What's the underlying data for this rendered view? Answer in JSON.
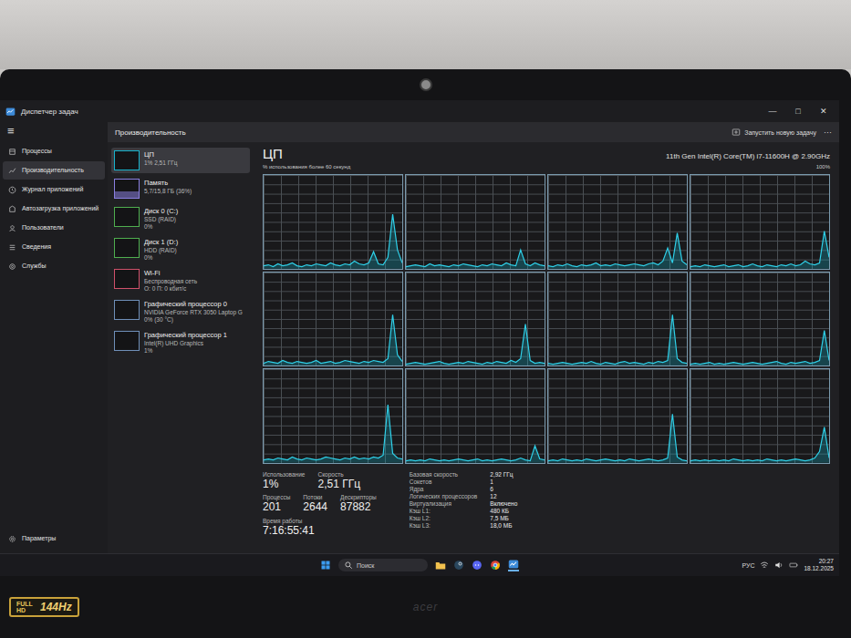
{
  "window": {
    "title": "Диспетчер задач",
    "controls": [
      "—",
      "□",
      "✕"
    ]
  },
  "nav": {
    "menu_glyph": "≡",
    "items": [
      {
        "label": "Процессы",
        "selected": false
      },
      {
        "label": "Производительность",
        "selected": true
      },
      {
        "label": "Журнал приложений",
        "selected": false
      },
      {
        "label": "Автозагрузка приложений",
        "selected": false
      },
      {
        "label": "Пользователи",
        "selected": false
      },
      {
        "label": "Сведения",
        "selected": false
      },
      {
        "label": "Службы",
        "selected": false
      }
    ],
    "footer": "Параметры"
  },
  "header": {
    "title": "Производительность",
    "action": "Запустить новую задачу",
    "more": "···"
  },
  "devices": [
    {
      "name": "ЦП",
      "lines": [
        "1% 2,51 ГГц"
      ],
      "selected": true,
      "color": "#17b3cc",
      "level": 0.01
    },
    {
      "name": "Память",
      "lines": [
        "5,7/15,8 ГБ (36%)"
      ],
      "selected": false,
      "color": "#8a7fe0",
      "level": 0.36
    },
    {
      "name": "Диск 0 (C:)",
      "lines": [
        "SSD (RAID)",
        "0%"
      ],
      "selected": false,
      "color": "#4fae4f",
      "level": 0
    },
    {
      "name": "Диск 1 (D:)",
      "lines": [
        "HDD (RAID)",
        "0%"
      ],
      "selected": false,
      "color": "#4fae4f",
      "level": 0
    },
    {
      "name": "Wi-Fi",
      "lines": [
        "Беспроводная сеть",
        "О: 0 П: 0 кбит/с"
      ],
      "selected": false,
      "color": "#d0506a",
      "level": 0
    },
    {
      "name": "Графический процессор 0",
      "lines": [
        "NVIDIA GeForce RTX 3050 Laptop G",
        "0% (30 °C)"
      ],
      "selected": false,
      "color": "#6f8fb8",
      "level": 0
    },
    {
      "name": "Графический процессор 1",
      "lines": [
        "Intel(R) UHD Graphics",
        "1%"
      ],
      "selected": false,
      "color": "#6f8fb8",
      "level": 0.01
    }
  ],
  "cpu": {
    "title": "ЦП",
    "model": "11th Gen Intel(R) Core(TM) i7-11600H @ 2.90GHz",
    "chart_caption": "% использования более 60 секунд",
    "chart_max": "100%",
    "series": [
      [
        3,
        4,
        2,
        5,
        3,
        4,
        6,
        3,
        2,
        4,
        3,
        5,
        4,
        3,
        6,
        4,
        3,
        5,
        4,
        8,
        5,
        4,
        6,
        18,
        5,
        4,
        12,
        58,
        20,
        6
      ],
      [
        2,
        3,
        4,
        3,
        2,
        5,
        3,
        4,
        3,
        2,
        4,
        3,
        5,
        4,
        3,
        2,
        4,
        3,
        5,
        4,
        3,
        6,
        4,
        3,
        20,
        5,
        3,
        6,
        4,
        3
      ],
      [
        3,
        2,
        4,
        3,
        5,
        3,
        2,
        4,
        3,
        4,
        6,
        3,
        4,
        3,
        5,
        4,
        3,
        4,
        5,
        4,
        3,
        5,
        6,
        4,
        8,
        22,
        6,
        38,
        8,
        4
      ],
      [
        2,
        3,
        2,
        4,
        3,
        2,
        3,
        4,
        2,
        3,
        4,
        2,
        3,
        5,
        3,
        2,
        4,
        3,
        2,
        4,
        3,
        5,
        3,
        4,
        8,
        5,
        4,
        6,
        40,
        12
      ],
      [
        3,
        5,
        4,
        3,
        6,
        4,
        3,
        5,
        4,
        3,
        4,
        6,
        3,
        4,
        5,
        3,
        4,
        6,
        5,
        4,
        3,
        5,
        4,
        6,
        5,
        4,
        8,
        55,
        12,
        5
      ],
      [
        2,
        3,
        4,
        3,
        2,
        3,
        4,
        5,
        3,
        2,
        3,
        4,
        3,
        5,
        4,
        3,
        2,
        4,
        3,
        5,
        4,
        3,
        6,
        4,
        8,
        45,
        6,
        3,
        4,
        3
      ],
      [
        3,
        2,
        3,
        4,
        3,
        2,
        3,
        4,
        3,
        5,
        3,
        2,
        4,
        3,
        2,
        4,
        5,
        3,
        4,
        3,
        2,
        4,
        3,
        5,
        4,
        6,
        55,
        8,
        4,
        3
      ],
      [
        2,
        3,
        2,
        3,
        4,
        2,
        3,
        2,
        3,
        4,
        3,
        2,
        3,
        4,
        3,
        2,
        3,
        4,
        5,
        3,
        2,
        4,
        3,
        4,
        5,
        3,
        4,
        6,
        38,
        6
      ],
      [
        3,
        4,
        3,
        5,
        4,
        3,
        6,
        4,
        3,
        5,
        4,
        3,
        4,
        6,
        5,
        4,
        3,
        5,
        4,
        6,
        4,
        5,
        4,
        6,
        5,
        8,
        62,
        10,
        5,
        4
      ],
      [
        2,
        3,
        2,
        3,
        2,
        4,
        3,
        2,
        3,
        2,
        3,
        4,
        3,
        2,
        3,
        4,
        2,
        3,
        2,
        3,
        4,
        3,
        2,
        3,
        5,
        3,
        2,
        18,
        4,
        3
      ],
      [
        2,
        3,
        2,
        4,
        3,
        2,
        3,
        2,
        4,
        3,
        2,
        3,
        4,
        3,
        2,
        3,
        2,
        4,
        3,
        2,
        3,
        4,
        3,
        2,
        3,
        5,
        52,
        6,
        3,
        2
      ],
      [
        2,
        3,
        2,
        3,
        2,
        3,
        2,
        3,
        2,
        4,
        3,
        2,
        3,
        2,
        3,
        2,
        4,
        3,
        2,
        3,
        2,
        3,
        4,
        3,
        2,
        3,
        5,
        12,
        38,
        5
      ]
    ],
    "primary": [
      {
        "label": "Использование",
        "value": "1%"
      },
      {
        "label": "Скорость",
        "value": "2,51 ГГц"
      }
    ],
    "secondary": [
      {
        "label": "Процессы",
        "value": "201"
      },
      {
        "label": "Потоки",
        "value": "2644"
      },
      {
        "label": "Дескрипторы",
        "value": "87882"
      }
    ],
    "uptime": {
      "label": "Время работы",
      "value": "7:16:55:41"
    },
    "specs": [
      {
        "label": "Базовая скорость",
        "value": "2,92 ГГц"
      },
      {
        "label": "Сокетов",
        "value": "1"
      },
      {
        "label": "Ядра",
        "value": "6"
      },
      {
        "label": "Логических процессоров",
        "value": "12"
      },
      {
        "label": "Виртуализация",
        "value": "Включено"
      },
      {
        "label": "Кэш L1:",
        "value": "480 КБ"
      },
      {
        "label": "Кэш L2:",
        "value": "7,5 МБ"
      },
      {
        "label": "Кэш L3:",
        "value": "18,0 МБ"
      }
    ]
  },
  "taskbar": {
    "search": "Поиск",
    "apps": [
      {
        "kind": "explorer"
      },
      {
        "kind": "steam"
      },
      {
        "kind": "chat"
      },
      {
        "kind": "chrome"
      },
      {
        "kind": "taskmgr"
      }
    ],
    "language": "РУС",
    "time": "20:27",
    "date": "18.12.2025"
  },
  "laptop": {
    "sticker": [
      "FULL HD",
      "144Hz"
    ],
    "brand": "acer"
  }
}
